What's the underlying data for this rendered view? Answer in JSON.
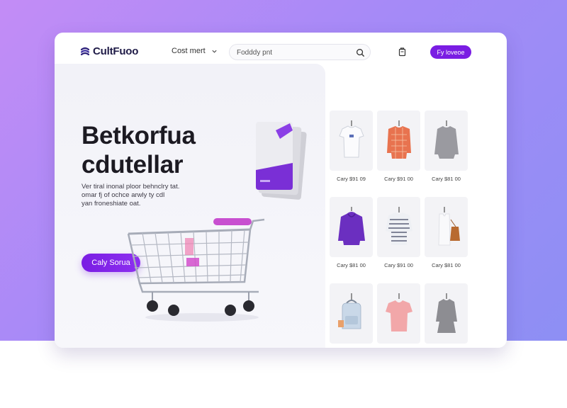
{
  "brand": {
    "name": "CultFuoo",
    "accent": "#7a1de3"
  },
  "header": {
    "category_label": "Cost mert",
    "search_placeholder": "Fodddy pnt",
    "cta_label": "Fy loveoe",
    "icons": [
      "logo-icon",
      "chevron-down-icon",
      "search-icon",
      "cart-icon"
    ]
  },
  "hero": {
    "title_lines": [
      "Betkorfua",
      "cdutellar"
    ],
    "desc_lines": [
      "Ver tiral inonal ploor behnclry tat.",
      "omar fj of ochce arwly ty cdl",
      "yan froneshiate oat."
    ],
    "cta_label": "Caly Sorua"
  },
  "products": [
    {
      "price": "Cary $91 09",
      "item": "white-tshirt",
      "color": "#ffffff"
    },
    {
      "price": "Cary $91 00",
      "item": "orange-plaid-shirt",
      "color": "#e8734f"
    },
    {
      "price": "Cary $81 00",
      "item": "grey-long-sleeve",
      "color": "#9a9aa0"
    },
    {
      "price": "Cary $81 00",
      "item": "purple-hoodie",
      "color": "#6b2fc0"
    },
    {
      "price": "Cary $91 00",
      "item": "striped-top",
      "color": "#b8bcc8"
    },
    {
      "price": "Cary $81 00",
      "item": "white-tank-bag",
      "color": "#f6f6f6"
    },
    {
      "price": "",
      "item": "light-blue-backpack",
      "color": "#c9d8e8"
    },
    {
      "price": "",
      "item": "pink-tshirt",
      "color": "#f2a7a9"
    },
    {
      "price": "",
      "item": "grey-dress",
      "color": "#8d8d92"
    }
  ]
}
